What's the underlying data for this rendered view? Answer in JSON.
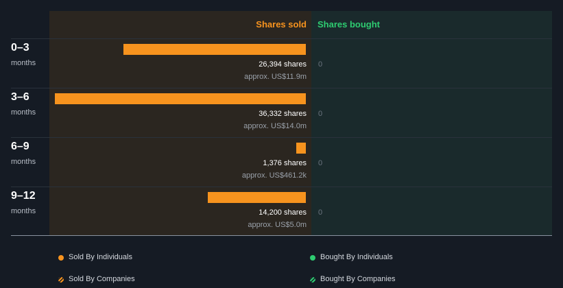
{
  "headers": {
    "sold": "Shares sold",
    "bought": "Shares bought"
  },
  "chart_data": {
    "type": "bar",
    "orientation": "horizontal",
    "categories": [
      "0–3",
      "3–6",
      "6–9",
      "9–12"
    ],
    "category_unit": "months",
    "series": [
      {
        "name": "Shares sold",
        "values": [
          26394,
          36332,
          1376,
          14200
        ],
        "color": "#f7931e"
      },
      {
        "name": "Shares bought",
        "values": [
          0,
          0,
          0,
          0
        ],
        "color": "#2ecc71"
      }
    ],
    "xlim": [
      0,
      36332
    ]
  },
  "rows": [
    {
      "period": "0–3",
      "unit": "months",
      "shares": "26,394 shares",
      "approx": "approx. US$11.9m",
      "bought": "0"
    },
    {
      "period": "3–6",
      "unit": "months",
      "shares": "36,332 shares",
      "approx": "approx. US$14.0m",
      "bought": "0"
    },
    {
      "period": "6–9",
      "unit": "months",
      "shares": "1,376 shares",
      "approx": "approx. US$461.2k",
      "bought": "0"
    },
    {
      "period": "9–12",
      "unit": "months",
      "shares": "14,200 shares",
      "approx": "approx. US$5.0m",
      "bought": "0"
    }
  ],
  "legend": {
    "sold_individuals": "Sold By Individuals",
    "bought_individuals": "Bought By Individuals",
    "sold_companies": "Sold By Companies",
    "bought_companies": "Bought By Companies"
  },
  "colors": {
    "sold": "#f7931e",
    "bought": "#2ecc71",
    "background": "#151b24"
  }
}
